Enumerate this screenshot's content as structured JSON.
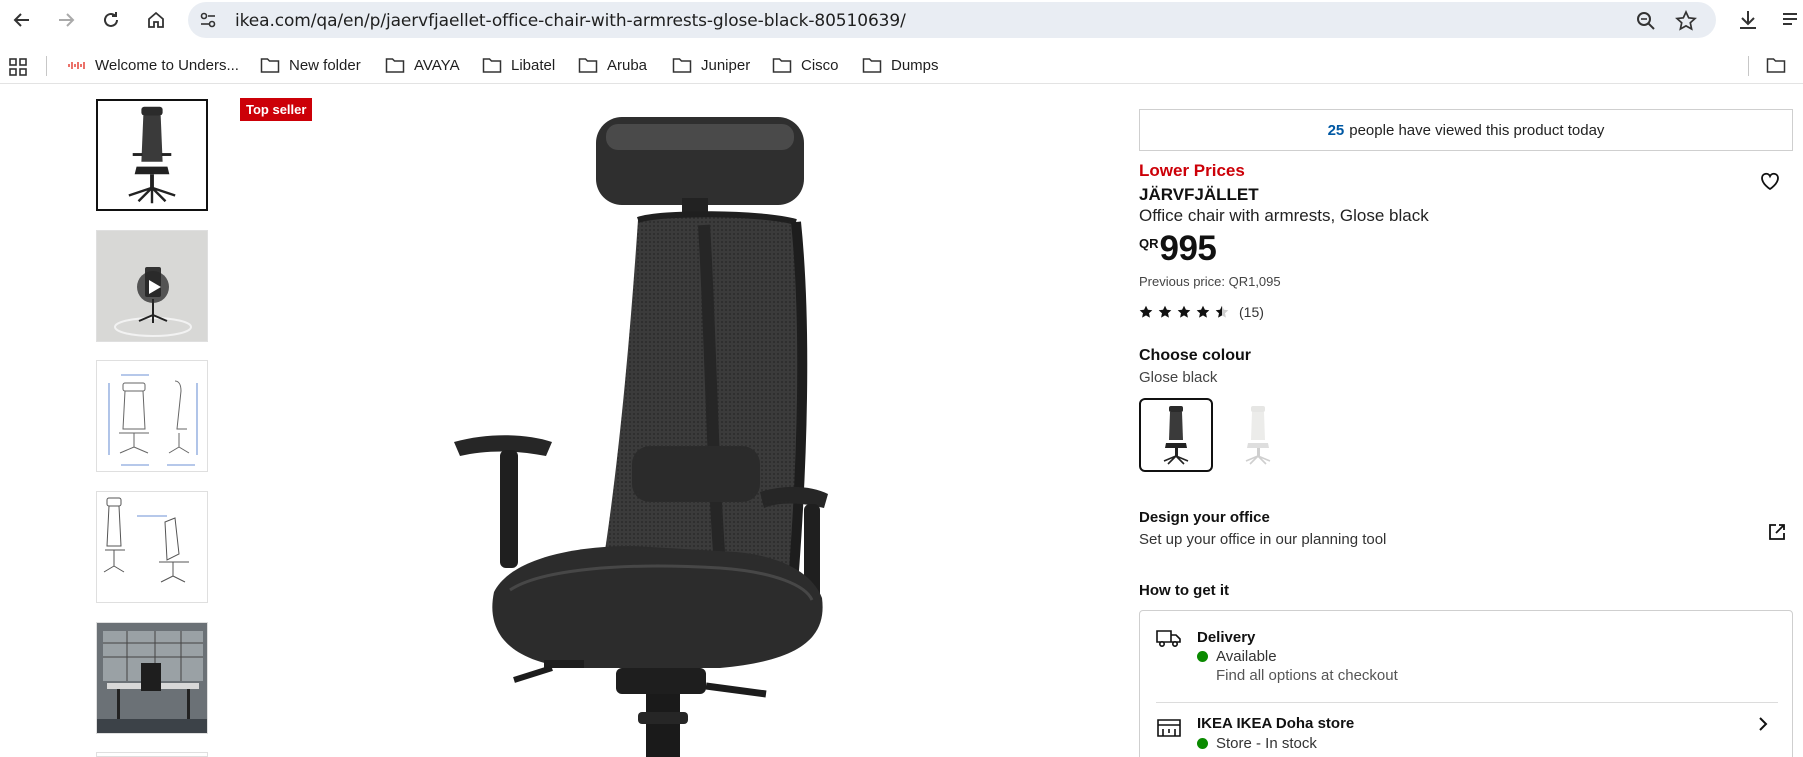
{
  "browser": {
    "url": "ikea.com/qa/en/p/jaervfjaellet-office-chair-with-armrests-glose-black-80510639/"
  },
  "bookmarks": [
    {
      "label": "Welcome to Unders..."
    },
    {
      "label": "New folder"
    },
    {
      "label": "AVAYA"
    },
    {
      "label": "Libatel"
    },
    {
      "label": "Aruba"
    },
    {
      "label": "Juniper"
    },
    {
      "label": "Cisco"
    },
    {
      "label": "Dumps"
    }
  ],
  "gallery": {
    "badge": "Top seller"
  },
  "product": {
    "viewed_count": "25",
    "viewed_text": "people have viewed this product today",
    "promo": "Lower Prices",
    "name": "JÄRVFJÄLLET",
    "description": "Office chair with armrests, Glose black",
    "currency": "QR",
    "price": "995",
    "previous_price": "Previous price: QR1,095",
    "rating": 4.5,
    "rating_count": "(15)"
  },
  "colour": {
    "label": "Choose colour",
    "selected": "Glose black"
  },
  "design": {
    "title": "Design your office",
    "subtitle": "Set up your office in our planning tool"
  },
  "availability": {
    "heading": "How to get it",
    "delivery_title": "Delivery",
    "delivery_status": "Available",
    "delivery_note": "Find all options at checkout",
    "store_title": "IKEA IKEA Doha store",
    "store_status": "Store - In stock",
    "status_color": "#0a8a00"
  },
  "colors": {
    "promo_red": "#cc0008",
    "link_blue": "#0058a3"
  }
}
